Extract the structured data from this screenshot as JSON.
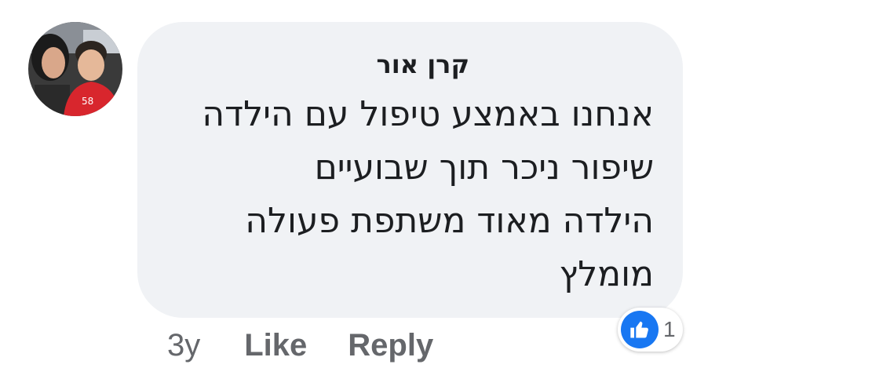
{
  "comment": {
    "author": "קרן אור",
    "lines": [
      "אנחנו באמצע טיפול עם הילדה",
      "שיפור ניכר תוך שבועיים",
      "הילדה מאוד משתפת פעולה",
      "מומלץ"
    ],
    "timestamp": "3y",
    "like_label": "Like",
    "reply_label": "Reply",
    "reaction_count": "1",
    "reaction_icon": "thumbs-up-icon",
    "colors": {
      "bubble": "#f0f2f5",
      "like_blue": "#1877f2",
      "meta_gray": "#65676b"
    }
  }
}
